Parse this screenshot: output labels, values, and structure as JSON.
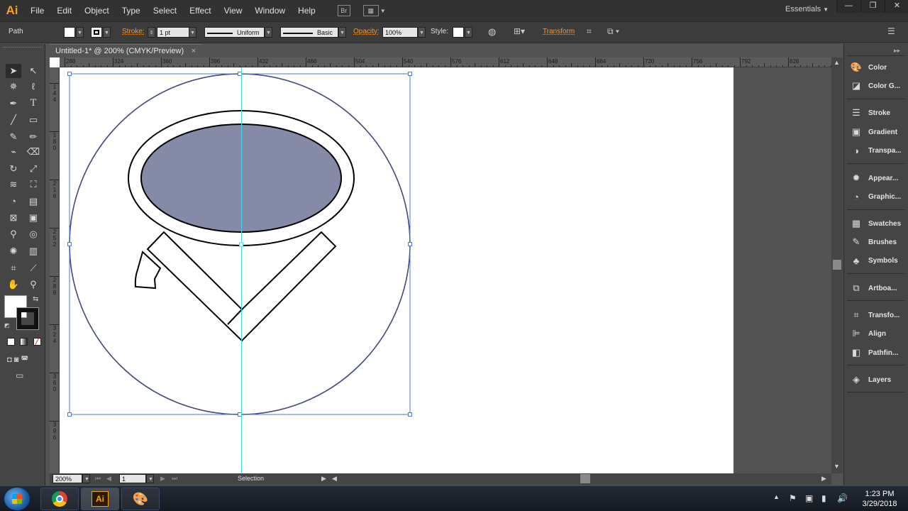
{
  "app": {
    "logo": "Ai",
    "menu": [
      "File",
      "Edit",
      "Object",
      "Type",
      "Select",
      "Effect",
      "View",
      "Window",
      "Help"
    ],
    "bridge_icon": "Br",
    "workspace": "Essentials",
    "window_buttons": [
      "—",
      "❐",
      "✕"
    ]
  },
  "control_bar": {
    "selection_type": "Path",
    "stroke_label": "Stroke:",
    "stroke_weight": "1 pt",
    "variable_width": "Uniform",
    "brush": "Basic",
    "opacity_label": "Opacity:",
    "opacity_value": "100%",
    "style_label": "Style:",
    "transform_label": "Transform"
  },
  "document": {
    "tab_title": "Untitled-1* @ 200% (CMYK/Preview)",
    "close": "×",
    "ruler_h": [
      "288",
      "324",
      "360",
      "396",
      "432",
      "468",
      "504",
      "540",
      "576",
      "612",
      "648",
      "684",
      "720",
      "756",
      "792",
      "828"
    ],
    "ruler_v": [
      {
        "digits": [
          "1",
          "4",
          "4"
        ]
      },
      {
        "digits": [
          "1",
          "8",
          "0"
        ]
      },
      {
        "digits": [
          "2",
          "1",
          "6"
        ]
      },
      {
        "digits": [
          "2",
          "5",
          "2"
        ]
      },
      {
        "digits": [
          "2",
          "8",
          "8"
        ]
      },
      {
        "digits": [
          "3",
          "2",
          "4"
        ]
      },
      {
        "digits": [
          "3",
          "6",
          "0"
        ]
      },
      {
        "digits": [
          "3",
          "9",
          "6"
        ]
      }
    ]
  },
  "status_bar": {
    "zoom": "200%",
    "artboard": "1",
    "current_tool": "Selection"
  },
  "panels": [
    {
      "label": "Color",
      "icon": "color-icon"
    },
    {
      "label": "Color G...",
      "icon": "color-guide-icon"
    },
    {
      "label": "Stroke",
      "icon": "stroke-icon"
    },
    {
      "label": "Gradient",
      "icon": "gradient-icon"
    },
    {
      "label": "Transpa...",
      "icon": "transparency-icon"
    },
    {
      "label": "Appear...",
      "icon": "appearance-icon"
    },
    {
      "label": "Graphic...",
      "icon": "graphic-styles-icon"
    },
    {
      "label": "Swatches",
      "icon": "swatches-icon"
    },
    {
      "label": "Brushes",
      "icon": "brushes-icon"
    },
    {
      "label": "Symbols",
      "icon": "symbols-icon"
    },
    {
      "label": "Artboa...",
      "icon": "artboards-icon"
    },
    {
      "label": "Transfo...",
      "icon": "transform-icon"
    },
    {
      "label": "Align",
      "icon": "align-icon"
    },
    {
      "label": "Pathfin...",
      "icon": "pathfinder-icon"
    },
    {
      "label": "Layers",
      "icon": "layers-icon"
    }
  ],
  "taskbar": {
    "time": "1:23 PM",
    "date": "3/29/2018",
    "apps": [
      "chrome-icon",
      "illustrator-icon",
      "paint-icon"
    ],
    "illustrator_label": "Ai"
  },
  "colors": {
    "selection": "#4a5fc0",
    "guide": "#47d4e6",
    "ellipse_fill": "#858aa6",
    "accent": "#f7a21b"
  }
}
